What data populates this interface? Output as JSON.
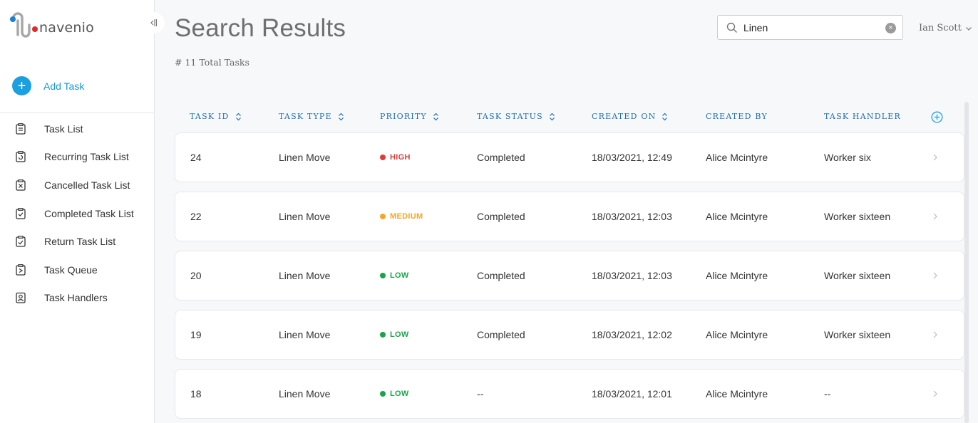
{
  "sidebar": {
    "brand": "navenio",
    "add_task_label": "Add Task",
    "items": [
      {
        "label": "Task List",
        "icon": "task-list-icon"
      },
      {
        "label": "Recurring Task List",
        "icon": "recurring-task-icon"
      },
      {
        "label": "Cancelled Task List",
        "icon": "cancelled-task-icon"
      },
      {
        "label": "Completed Task List",
        "icon": "completed-task-icon"
      },
      {
        "label": "Return Task List",
        "icon": "return-task-icon"
      },
      {
        "label": "Task Queue",
        "icon": "task-queue-icon"
      },
      {
        "label": "Task Handlers",
        "icon": "task-handlers-icon"
      }
    ]
  },
  "header": {
    "title": "Search Results",
    "total": "# 11 Total Tasks",
    "search_value": "Linen",
    "user_name": "Ian Scott"
  },
  "table": {
    "columns": [
      "TASK ID",
      "TASK TYPE",
      "PRIORITY",
      "TASK STATUS",
      "CREATED ON",
      "CREATED BY",
      "TASK HANDLER"
    ],
    "rows": [
      {
        "id": "24",
        "type": "Linen Move",
        "priority": "HIGH",
        "priority_color": "#e03a3a",
        "status": "Completed",
        "created_on": "18/03/2021, 12:49",
        "created_by": "Alice Mcintyre",
        "handler": "Worker six"
      },
      {
        "id": "22",
        "type": "Linen Move",
        "priority": "MEDIUM",
        "priority_color": "#f5a623",
        "status": "Completed",
        "created_on": "18/03/2021, 12:03",
        "created_by": "Alice Mcintyre",
        "handler": "Worker sixteen"
      },
      {
        "id": "20",
        "type": "Linen Move",
        "priority": "LOW",
        "priority_color": "#1aa34a",
        "status": "Completed",
        "created_on": "18/03/2021, 12:03",
        "created_by": "Alice Mcintyre",
        "handler": "Worker sixteen"
      },
      {
        "id": "19",
        "type": "Linen Move",
        "priority": "LOW",
        "priority_color": "#1aa34a",
        "status": "Completed",
        "created_on": "18/03/2021, 12:02",
        "created_by": "Alice Mcintyre",
        "handler": "Worker sixteen"
      },
      {
        "id": "18",
        "type": "Linen Move",
        "priority": "LOW",
        "priority_color": "#1aa34a",
        "status": "--",
        "created_on": "18/03/2021, 12:01",
        "created_by": "Alice Mcintyre",
        "handler": "--"
      }
    ]
  },
  "colors": {
    "accent": "#1aa0e0",
    "header_text": "#1e6fb0"
  }
}
